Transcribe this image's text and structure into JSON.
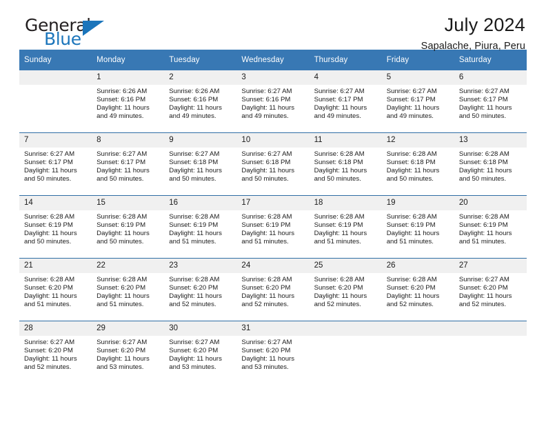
{
  "brand": {
    "name_top": "General",
    "name_bottom": "Blue",
    "accent_color": "#1b75bb",
    "triangle_icon": "triangle-icon"
  },
  "header": {
    "title": "July 2024",
    "subtitle": "Sapalache, Piura, Peru"
  },
  "calendar": {
    "header_bg": "#3878b4",
    "daynum_bg": "#f0f0f0",
    "grid_line_color": "#2e6da4",
    "weekdays": [
      "Sunday",
      "Monday",
      "Tuesday",
      "Wednesday",
      "Thursday",
      "Friday",
      "Saturday"
    ],
    "labels": {
      "sunrise": "Sunrise:",
      "sunset": "Sunset:",
      "daylight": "Daylight:"
    },
    "weeks": [
      [
        {
          "day": "",
          "empty": true
        },
        {
          "day": "1",
          "sunrise": "Sunrise: 6:26 AM",
          "sunset": "Sunset: 6:16 PM",
          "daylight": "Daylight: 11 hours and 49 minutes."
        },
        {
          "day": "2",
          "sunrise": "Sunrise: 6:26 AM",
          "sunset": "Sunset: 6:16 PM",
          "daylight": "Daylight: 11 hours and 49 minutes."
        },
        {
          "day": "3",
          "sunrise": "Sunrise: 6:27 AM",
          "sunset": "Sunset: 6:16 PM",
          "daylight": "Daylight: 11 hours and 49 minutes."
        },
        {
          "day": "4",
          "sunrise": "Sunrise: 6:27 AM",
          "sunset": "Sunset: 6:17 PM",
          "daylight": "Daylight: 11 hours and 49 minutes."
        },
        {
          "day": "5",
          "sunrise": "Sunrise: 6:27 AM",
          "sunset": "Sunset: 6:17 PM",
          "daylight": "Daylight: 11 hours and 49 minutes."
        },
        {
          "day": "6",
          "sunrise": "Sunrise: 6:27 AM",
          "sunset": "Sunset: 6:17 PM",
          "daylight": "Daylight: 11 hours and 50 minutes."
        }
      ],
      [
        {
          "day": "7",
          "sunrise": "Sunrise: 6:27 AM",
          "sunset": "Sunset: 6:17 PM",
          "daylight": "Daylight: 11 hours and 50 minutes."
        },
        {
          "day": "8",
          "sunrise": "Sunrise: 6:27 AM",
          "sunset": "Sunset: 6:17 PM",
          "daylight": "Daylight: 11 hours and 50 minutes."
        },
        {
          "day": "9",
          "sunrise": "Sunrise: 6:27 AM",
          "sunset": "Sunset: 6:18 PM",
          "daylight": "Daylight: 11 hours and 50 minutes."
        },
        {
          "day": "10",
          "sunrise": "Sunrise: 6:27 AM",
          "sunset": "Sunset: 6:18 PM",
          "daylight": "Daylight: 11 hours and 50 minutes."
        },
        {
          "day": "11",
          "sunrise": "Sunrise: 6:28 AM",
          "sunset": "Sunset: 6:18 PM",
          "daylight": "Daylight: 11 hours and 50 minutes."
        },
        {
          "day": "12",
          "sunrise": "Sunrise: 6:28 AM",
          "sunset": "Sunset: 6:18 PM",
          "daylight": "Daylight: 11 hours and 50 minutes."
        },
        {
          "day": "13",
          "sunrise": "Sunrise: 6:28 AM",
          "sunset": "Sunset: 6:18 PM",
          "daylight": "Daylight: 11 hours and 50 minutes."
        }
      ],
      [
        {
          "day": "14",
          "sunrise": "Sunrise: 6:28 AM",
          "sunset": "Sunset: 6:19 PM",
          "daylight": "Daylight: 11 hours and 50 minutes."
        },
        {
          "day": "15",
          "sunrise": "Sunrise: 6:28 AM",
          "sunset": "Sunset: 6:19 PM",
          "daylight": "Daylight: 11 hours and 50 minutes."
        },
        {
          "day": "16",
          "sunrise": "Sunrise: 6:28 AM",
          "sunset": "Sunset: 6:19 PM",
          "daylight": "Daylight: 11 hours and 51 minutes."
        },
        {
          "day": "17",
          "sunrise": "Sunrise: 6:28 AM",
          "sunset": "Sunset: 6:19 PM",
          "daylight": "Daylight: 11 hours and 51 minutes."
        },
        {
          "day": "18",
          "sunrise": "Sunrise: 6:28 AM",
          "sunset": "Sunset: 6:19 PM",
          "daylight": "Daylight: 11 hours and 51 minutes."
        },
        {
          "day": "19",
          "sunrise": "Sunrise: 6:28 AM",
          "sunset": "Sunset: 6:19 PM",
          "daylight": "Daylight: 11 hours and 51 minutes."
        },
        {
          "day": "20",
          "sunrise": "Sunrise: 6:28 AM",
          "sunset": "Sunset: 6:19 PM",
          "daylight": "Daylight: 11 hours and 51 minutes."
        }
      ],
      [
        {
          "day": "21",
          "sunrise": "Sunrise: 6:28 AM",
          "sunset": "Sunset: 6:20 PM",
          "daylight": "Daylight: 11 hours and 51 minutes."
        },
        {
          "day": "22",
          "sunrise": "Sunrise: 6:28 AM",
          "sunset": "Sunset: 6:20 PM",
          "daylight": "Daylight: 11 hours and 51 minutes."
        },
        {
          "day": "23",
          "sunrise": "Sunrise: 6:28 AM",
          "sunset": "Sunset: 6:20 PM",
          "daylight": "Daylight: 11 hours and 52 minutes."
        },
        {
          "day": "24",
          "sunrise": "Sunrise: 6:28 AM",
          "sunset": "Sunset: 6:20 PM",
          "daylight": "Daylight: 11 hours and 52 minutes."
        },
        {
          "day": "25",
          "sunrise": "Sunrise: 6:28 AM",
          "sunset": "Sunset: 6:20 PM",
          "daylight": "Daylight: 11 hours and 52 minutes."
        },
        {
          "day": "26",
          "sunrise": "Sunrise: 6:28 AM",
          "sunset": "Sunset: 6:20 PM",
          "daylight": "Daylight: 11 hours and 52 minutes."
        },
        {
          "day": "27",
          "sunrise": "Sunrise: 6:27 AM",
          "sunset": "Sunset: 6:20 PM",
          "daylight": "Daylight: 11 hours and 52 minutes."
        }
      ],
      [
        {
          "day": "28",
          "sunrise": "Sunrise: 6:27 AM",
          "sunset": "Sunset: 6:20 PM",
          "daylight": "Daylight: 11 hours and 52 minutes."
        },
        {
          "day": "29",
          "sunrise": "Sunrise: 6:27 AM",
          "sunset": "Sunset: 6:20 PM",
          "daylight": "Daylight: 11 hours and 53 minutes."
        },
        {
          "day": "30",
          "sunrise": "Sunrise: 6:27 AM",
          "sunset": "Sunset: 6:20 PM",
          "daylight": "Daylight: 11 hours and 53 minutes."
        },
        {
          "day": "31",
          "sunrise": "Sunrise: 6:27 AM",
          "sunset": "Sunset: 6:20 PM",
          "daylight": "Daylight: 11 hours and 53 minutes."
        },
        {
          "day": "",
          "empty": true
        },
        {
          "day": "",
          "empty": true
        },
        {
          "day": "",
          "empty": true
        }
      ]
    ]
  }
}
